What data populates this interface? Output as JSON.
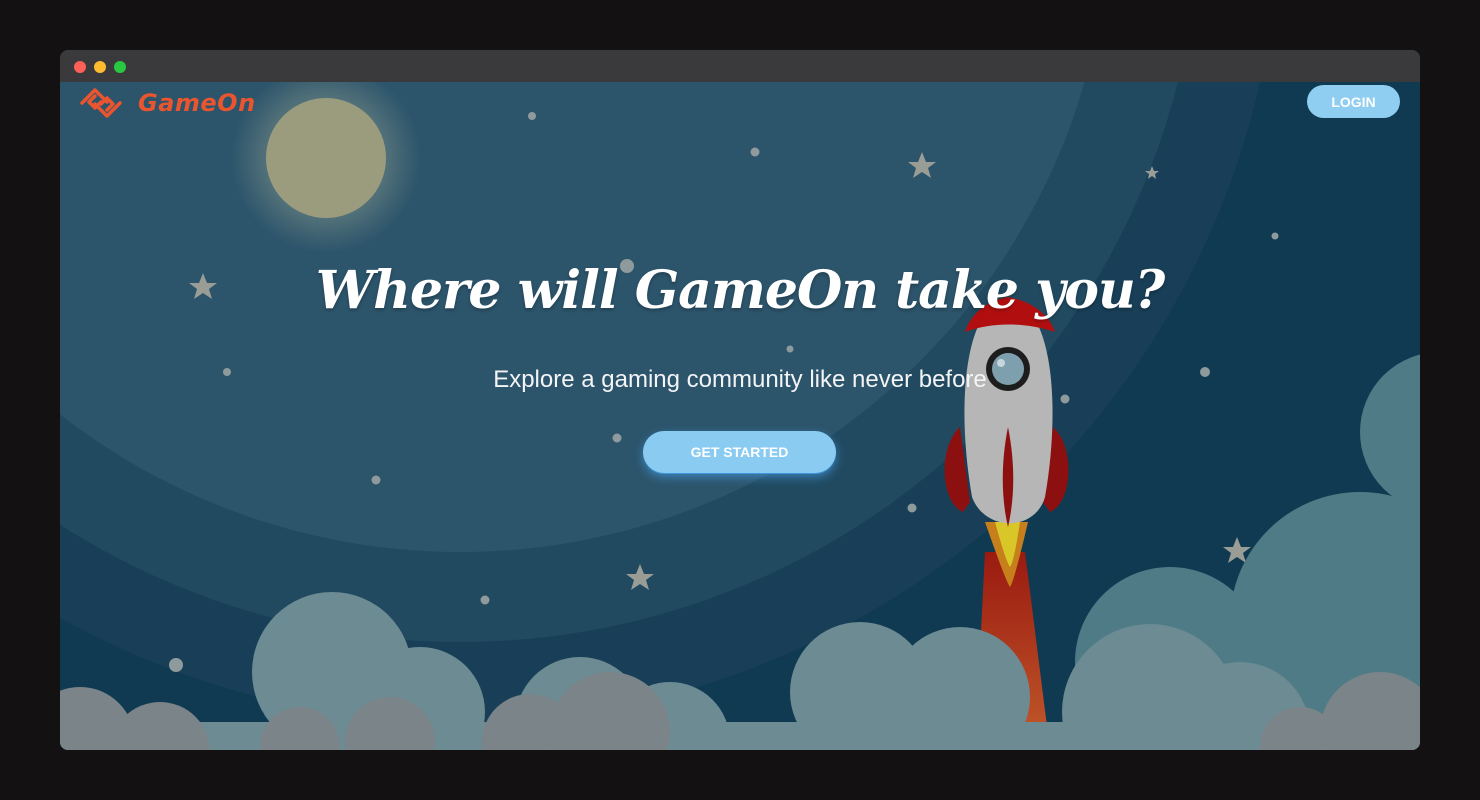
{
  "brand": {
    "name": "GameOn",
    "logo_icon": "gameon-logo-icon",
    "color": "#e9552f"
  },
  "header": {
    "login_label": "LOGIN"
  },
  "hero": {
    "headline": "Where will GameOn take you?",
    "subheadline": "Explore a gaming community like never before",
    "cta_label": "GET STARTED"
  },
  "colors": {
    "sky": "#0d3a52",
    "button": "#8fcdf1",
    "rocket_body": "#b8b8b8",
    "rocket_fins": "#9b0f0f"
  }
}
